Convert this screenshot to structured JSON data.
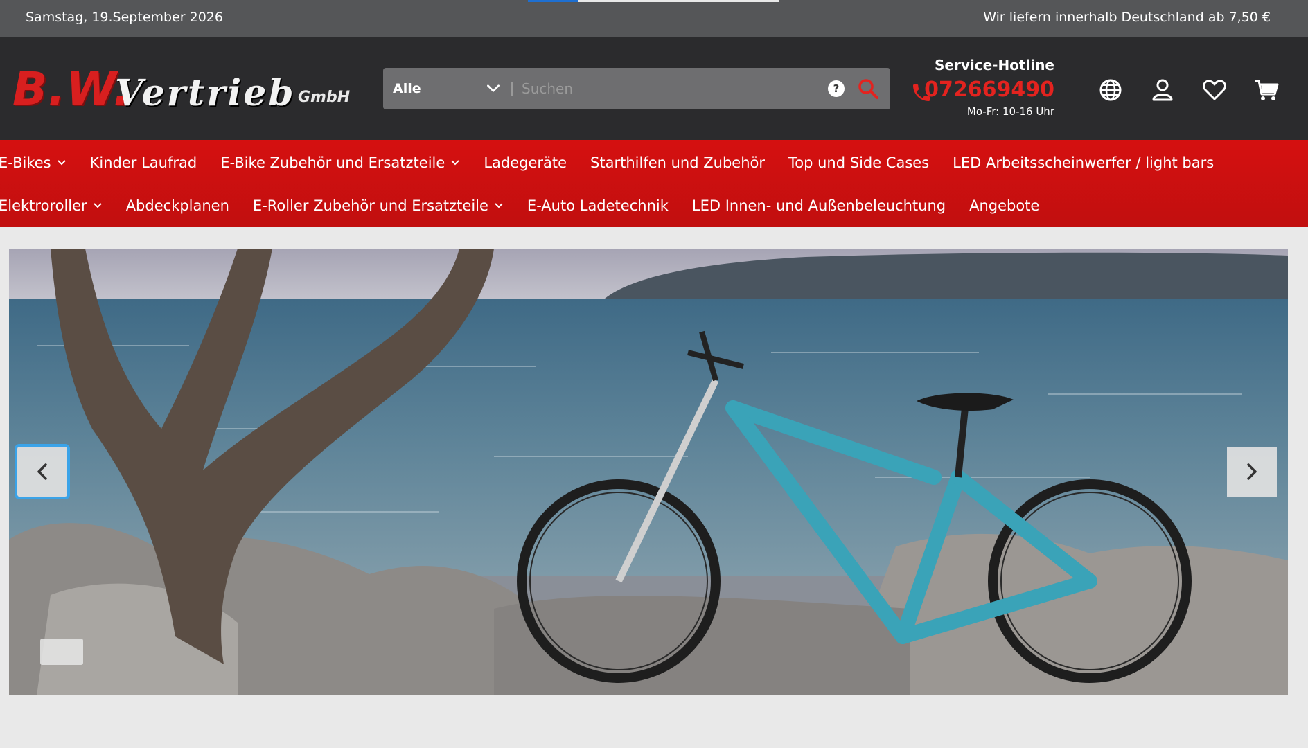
{
  "topbar": {
    "date": "Samstag, 19.September 2026",
    "shipping": "Wir liefern innerhalb Deutschland ab 7,50 €",
    "page_progress": 0.2
  },
  "header": {
    "logo": {
      "bw": "B.W.",
      "vertrieb": "Vertrieb",
      "gmbh": "GmbH"
    },
    "search": {
      "category": "Alle",
      "placeholder": "Suchen",
      "help": "?"
    },
    "hotline": {
      "label": "Service-Hotline",
      "number": "072669490",
      "hours": "Mo-Fr: 10-16 Uhr"
    },
    "icons": [
      "globe-icon",
      "user-icon",
      "heart-icon",
      "cart-icon"
    ]
  },
  "nav": {
    "row1": [
      {
        "label": "E-Bikes",
        "dropdown": true
      },
      {
        "label": "Kinder Laufrad",
        "dropdown": false
      },
      {
        "label": "E-Bike Zubehör und Ersatzteile",
        "dropdown": true
      },
      {
        "label": "Ladegeräte",
        "dropdown": false
      },
      {
        "label": "Starthilfen und Zubehör",
        "dropdown": false
      },
      {
        "label": "Top und Side Cases",
        "dropdown": false
      },
      {
        "label": "LED Arbeitsscheinwerfer / light bars",
        "dropdown": false
      }
    ],
    "row2": [
      {
        "label": "Elektroroller",
        "dropdown": true
      },
      {
        "label": "Abdeckplanen",
        "dropdown": false
      },
      {
        "label": "E-Roller Zubehör und Ersatzteile",
        "dropdown": true
      },
      {
        "label": "E-Auto Ladetechnik",
        "dropdown": false
      },
      {
        "label": "LED Innen- und Außenbeleuchtung",
        "dropdown": false
      },
      {
        "label": "Angebote",
        "dropdown": false
      }
    ]
  },
  "colors": {
    "topbar_bg": "#555658",
    "header_bg": "#2b2b2d",
    "nav_red": "#c90f0f",
    "accent_red": "#e3231f",
    "focus_blue": "#3aa3e8"
  }
}
